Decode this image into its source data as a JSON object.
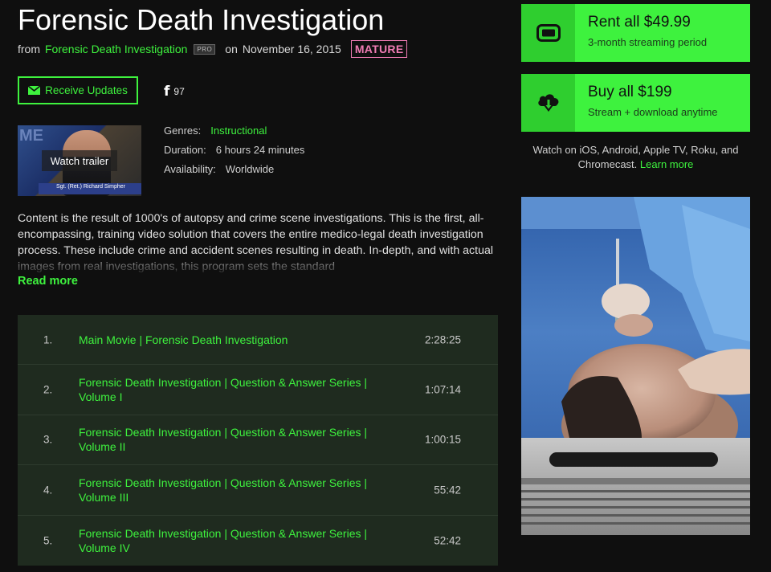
{
  "title": "Forensic Death Investigation",
  "byline": {
    "from_label": "from",
    "series_link": "Forensic Death Investigation",
    "pro_badge": "PRO",
    "on_label": "on",
    "date": "November 16, 2015",
    "rating_badge": "MATURE"
  },
  "actions": {
    "receive_updates": "Receive Updates",
    "facebook_count": "97"
  },
  "trailer": {
    "watch_label": "Watch trailer",
    "lower_third": "Sgt. (Ret.) Richard Simpher"
  },
  "meta": {
    "genres_label": "Genres:",
    "genres_value": "Instructional",
    "duration_label": "Duration:",
    "duration_value": "6 hours 24 minutes",
    "availability_label": "Availability:",
    "availability_value": "Worldwide"
  },
  "description": "Content is the result of 1000's of autopsy and crime scene investigations. This is the first, all-encompassing, training video solution that covers the entire medico-legal death investigation process. These include crime and accident scenes resulting in death. In-depth, and with actual images from real investigations, this program sets the standard",
  "read_more": "Read more",
  "episodes": [
    {
      "num": "1.",
      "name": "Main Movie | Forensic Death Investigation",
      "duration": "2:28:25"
    },
    {
      "num": "2.",
      "name": "Forensic Death Investigation | Question & Answer Series | Volume I",
      "duration": "1:07:14"
    },
    {
      "num": "3.",
      "name": "Forensic Death Investigation | Question & Answer Series | Volume II",
      "duration": "1:00:15"
    },
    {
      "num": "4.",
      "name": "Forensic Death Investigation | Question & Answer Series | Volume III",
      "duration": "55:42"
    },
    {
      "num": "5.",
      "name": "Forensic Death Investigation | Question & Answer Series | Volume IV",
      "duration": "52:42"
    }
  ],
  "purchase": {
    "rent_title": "Rent all $49.99",
    "rent_sub": "3-month streaming period",
    "buy_title": "Buy all $199",
    "buy_sub": "Stream + download anytime",
    "devices_text": "Watch on iOS, Android, Apple TV, Roku, and Chromecast.",
    "learn_more": "Learn more"
  },
  "colors": {
    "accent_green": "#3ef23e",
    "background": "#0f0f0f",
    "episode_panel": "#1f2b1f",
    "mature_pink": "#f07cb4"
  }
}
